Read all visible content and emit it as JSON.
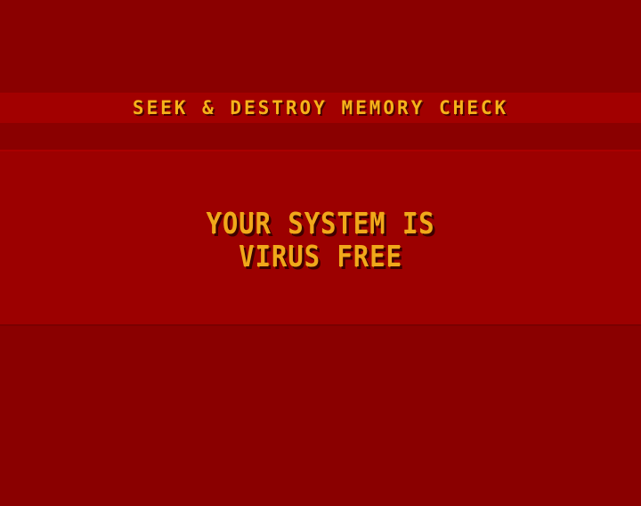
{
  "header": {
    "title": "SEEK & DESTROY MEMORY CHECK"
  },
  "message": {
    "line1": "YOUR SYSTEM IS",
    "line2": "VIRUS FREE"
  },
  "colors": {
    "background": "#8a0000",
    "header_band": "#a20000",
    "message_panel": "#9c0000",
    "text": "#f0a81a"
  }
}
